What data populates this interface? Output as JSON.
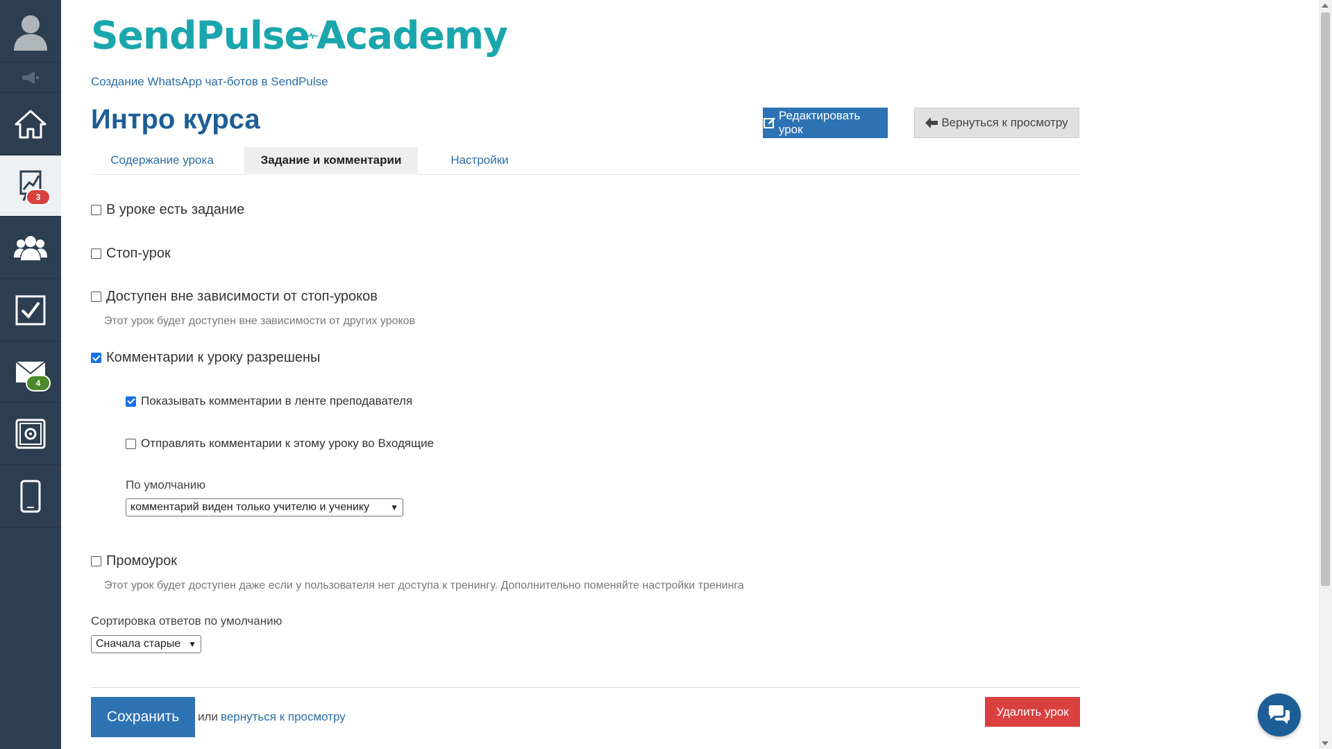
{
  "colors": {
    "sidebar_bg": "#2c3e50",
    "primary": "#2d73b3",
    "title": "#1d5e96",
    "logo": "#1aa6ad",
    "danger": "#d9413f",
    "badge_red": "#d9413f",
    "badge_green": "#4a8a2a"
  },
  "sidebar": {
    "items": [
      {
        "icon": "user-avatar-icon"
      },
      {
        "icon": "megaphone-icon"
      },
      {
        "icon": "home-icon"
      },
      {
        "icon": "chart-icon",
        "badge": "3",
        "active": true
      },
      {
        "icon": "users-group-icon"
      },
      {
        "icon": "checkbox-icon"
      },
      {
        "icon": "mail-icon",
        "badge": "4"
      },
      {
        "icon": "settings-safe-icon"
      },
      {
        "icon": "mobile-phone-icon"
      }
    ]
  },
  "header": {
    "logo_text": "SendPulse‑–Academy",
    "logo_left": "SendPulse",
    "logo_right": "Academy",
    "breadcrumb": "Создание WhatsApp чат-ботов в SendPulse",
    "title": "Интро курса",
    "edit_button": "Редактировать урок",
    "back_button": "Вернуться к просмотру"
  },
  "tabs": [
    {
      "label": "Содержание урока",
      "active": false
    },
    {
      "label": "Задание и комментарии",
      "active": true
    },
    {
      "label": "Настройки",
      "active": false
    }
  ],
  "form": {
    "has_task": {
      "label": "В уроке есть задание",
      "checked": false
    },
    "stop_lesson": {
      "label": "Стоп-урок",
      "checked": false
    },
    "independent": {
      "label": "Доступен вне зависимости от стоп-уроков",
      "checked": false,
      "hint": "Этот урок будет доступен вне зависимости от других уроков"
    },
    "comments_allowed": {
      "label": "Комментарии к уроку разрешены",
      "checked": true
    },
    "show_in_feed": {
      "label": "Показывать комментарии в ленте преподавателя",
      "checked": true
    },
    "send_to_inbox": {
      "label": "Отправлять комментарии к этому уроку во Входящие",
      "checked": false
    },
    "default_visibility": {
      "label": "По умолчанию",
      "value": "комментарий виден только учителю и ученику"
    },
    "promo": {
      "label": "Промоурок",
      "checked": false,
      "hint": "Этот урок будет доступен даже если у пользователя нет доступа к тренингу. Дополнительно поменяйте настройки тренинга"
    },
    "sort": {
      "label": "Сортировка ответов по умолчанию",
      "value": "Сначала старые"
    }
  },
  "footer": {
    "save": "Сохранить",
    "or": "или",
    "back_link": "вернуться к просмотру",
    "delete": "Удалить урок"
  },
  "chat": {
    "icon": "chat-bubbles-icon"
  }
}
